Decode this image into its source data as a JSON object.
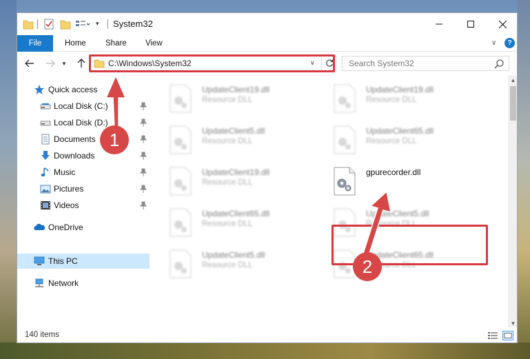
{
  "window": {
    "title": "System32",
    "minimize_glyph": "—",
    "maximize_glyph": "☐",
    "close_glyph": "✕"
  },
  "ribbon": {
    "tabs": [
      "File",
      "Home",
      "Share",
      "View"
    ],
    "help": "?"
  },
  "navigation": {
    "address": "C:\\Windows\\System32",
    "search_placeholder": "Search System32"
  },
  "sidebar": {
    "items": [
      {
        "label": "Quick access",
        "icon": "star-icon"
      },
      {
        "label": "Local Disk (C:)",
        "icon": "drive-icon",
        "pinned": true
      },
      {
        "label": "Local Disk (D:)",
        "icon": "drive-icon",
        "pinned": true
      },
      {
        "label": "Documents",
        "icon": "documents-icon",
        "pinned": true
      },
      {
        "label": "Downloads",
        "icon": "download-icon",
        "pinned": true
      },
      {
        "label": "Music",
        "icon": "music-icon",
        "pinned": true
      },
      {
        "label": "Pictures",
        "icon": "pictures-icon",
        "pinned": true
      },
      {
        "label": "Videos",
        "icon": "videos-icon",
        "pinned": true
      },
      {
        "label": "OneDrive",
        "icon": "onedrive-icon"
      },
      {
        "label": "This PC",
        "icon": "computer-icon",
        "selected": true
      },
      {
        "label": "Network",
        "icon": "network-icon"
      }
    ]
  },
  "files": [
    {
      "name": "UpdateClient19.dll",
      "type": "Resource DLL"
    },
    {
      "name": "UpdateClient19.dll",
      "type": "Resource DLL"
    },
    {
      "name": "UpdateClient5.dll",
      "type": "Resource DLL"
    },
    {
      "name": "UpdateClient65.dll",
      "type": "Resource DLL"
    },
    {
      "name": "UpdateClient19.dll",
      "type": "Resource DLL"
    },
    {
      "name": "gpurecorder.dll",
      "type": ""
    },
    {
      "name": "UpdateClient65.dll",
      "type": "Resource DLL"
    },
    {
      "name": "UpdateClient5.dll",
      "type": "Resource DLL"
    },
    {
      "name": "UpdateClient5.dll",
      "type": "Resource DLL"
    },
    {
      "name": "UpdateClient65.dll",
      "type": "Resource DLL"
    }
  ],
  "status": {
    "item_count": "140 items"
  },
  "annotations": {
    "step1": "1",
    "step2": "2"
  },
  "colors": {
    "accent": "#1979ca",
    "highlight_red": "#d5393f",
    "badge_red": "#d84747",
    "selected_nav": "#cce8ff"
  }
}
